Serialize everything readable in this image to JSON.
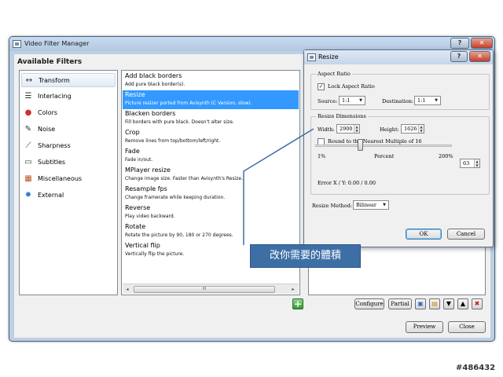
{
  "main_window": {
    "title": "Video Filter Manager",
    "help_glyph": "?",
    "close_glyph": "✕"
  },
  "available_filters": {
    "heading": "Available Filters",
    "categories": [
      {
        "label": "Transform",
        "icon": "transform-icon",
        "selected": true
      },
      {
        "label": "Interlacing",
        "icon": "interlacing-icon",
        "selected": false
      },
      {
        "label": "Colors",
        "icon": "colors-icon",
        "selected": false
      },
      {
        "label": "Noise",
        "icon": "noise-icon",
        "selected": false
      },
      {
        "label": "Sharpness",
        "icon": "sharpness-icon",
        "selected": false
      },
      {
        "label": "Subtitles",
        "icon": "subtitles-icon",
        "selected": false
      },
      {
        "label": "Miscellaneous",
        "icon": "miscellaneous-icon",
        "selected": false
      },
      {
        "label": "External",
        "icon": "external-icon",
        "selected": false
      }
    ],
    "filters": [
      {
        "name": "Add black borders",
        "desc": "Add pure black border(s).",
        "selected": false
      },
      {
        "name": "Resize",
        "desc": "Picture resizer ported from Avisynth (C Version, slow).",
        "selected": true
      },
      {
        "name": "Blacken borders",
        "desc": "Fill borders with pure black. Doesn't alter size.",
        "selected": false
      },
      {
        "name": "Crop",
        "desc": "Remove lines from top/bottom/left/right.",
        "selected": false
      },
      {
        "name": "Fade",
        "desc": "Fade in/out.",
        "selected": false
      },
      {
        "name": "MPlayer resize",
        "desc": "Change image size. Faster than Avisynth's Resize.",
        "selected": false
      },
      {
        "name": "Resample fps",
        "desc": "Change framerate while keeping duration.",
        "selected": false
      },
      {
        "name": "Reverse",
        "desc": "Play video backward.",
        "selected": false
      },
      {
        "name": "Rotate",
        "desc": "Rotate the picture by 90, 180 or 270 degrees.",
        "selected": false
      },
      {
        "name": "Vertical flip",
        "desc": "Vertically flip the picture.",
        "selected": false
      }
    ],
    "scroll_left": "◂",
    "scroll_right": "▸",
    "scroll_grip": "III",
    "add_glyph": "+"
  },
  "active_toolbar": {
    "configure": "Configure",
    "partial": "Partial"
  },
  "bottom_buttons": {
    "preview": "Preview",
    "close": "Close"
  },
  "resize_dialog": {
    "title": "Resize",
    "help_glyph": "?",
    "close_glyph": "✕",
    "aspect_ratio": {
      "group_label": "Aspect Ratio",
      "lock_label": "Lock Aspect Ratio",
      "lock_checked": true,
      "source_label": "Source:",
      "source_value": "1:1",
      "destination_label": "Destination:",
      "destination_value": "1:1"
    },
    "dimensions": {
      "group_label": "Resize Dimensions",
      "width_label": "Width:",
      "width_value": "2900",
      "height_label": "Height:",
      "height_value": "1626",
      "round_label": "Round to the Nearest Multiple of 16",
      "round_checked": false,
      "min_label": "1%",
      "percent_label": "Percent",
      "max_label": "200%",
      "percent_value": "63",
      "error_text": "Error X / Y:  0.00 / 0.00"
    },
    "method_label": "Resize Method:",
    "method_value": "Bilinear",
    "ok_label": "OK",
    "cancel_label": "Cancel"
  },
  "annotation": {
    "text": "改你需要的體積",
    "color": "#3d6fa5"
  },
  "watermark": "#486432",
  "colors": {
    "selection": "#3399ff",
    "window_frame": "#bcd0e4"
  }
}
